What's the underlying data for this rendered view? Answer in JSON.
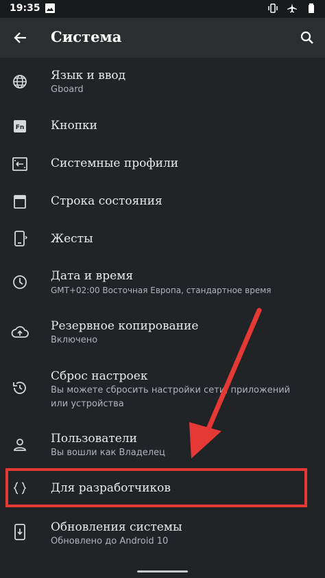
{
  "status_bar": {
    "time": "19:35",
    "left_icon": "image-icon",
    "right_icons": [
      "vibrate-icon",
      "airplane-icon",
      "battery-icon"
    ]
  },
  "appbar": {
    "title": "Система",
    "back_icon": "arrow-back-icon",
    "search_icon": "search-icon"
  },
  "items": [
    {
      "icon": "globe-icon",
      "title": "Язык и ввод",
      "subtitle": "Gboard"
    },
    {
      "icon": "fn-key-icon",
      "title": "Кнопки",
      "subtitle": ""
    },
    {
      "icon": "profiles-icon",
      "title": "Системные профили",
      "subtitle": ""
    },
    {
      "icon": "statusbar-icon",
      "title": "Строка состояния",
      "subtitle": ""
    },
    {
      "icon": "gestures-icon",
      "title": "Жесты",
      "subtitle": ""
    },
    {
      "icon": "clock-icon",
      "title": "Дата и время",
      "subtitle": "GMT+02:00 Восточная Европа, стандартное время"
    },
    {
      "icon": "cloud-upload-icon",
      "title": "Резервное копирование",
      "subtitle": "Включено"
    },
    {
      "icon": "history-icon",
      "title": "Сброс настроек",
      "subtitle": "Вы можете сбросить настройки сети, приложений или устройства"
    },
    {
      "icon": "person-icon",
      "title": "Пользователи",
      "subtitle": "Вы вошли как Владелец"
    },
    {
      "icon": "code-braces-icon",
      "title": "Для разработчиков",
      "subtitle": ""
    },
    {
      "icon": "system-update-icon",
      "title": "Обновления системы",
      "subtitle": "Обновлено до Android 10"
    }
  ],
  "colors": {
    "background": "#212427",
    "appbar": "#2b2e31",
    "text": "#e8eaed",
    "secondary_text": "#b0b4b8",
    "annotation_red": "#e53935"
  }
}
